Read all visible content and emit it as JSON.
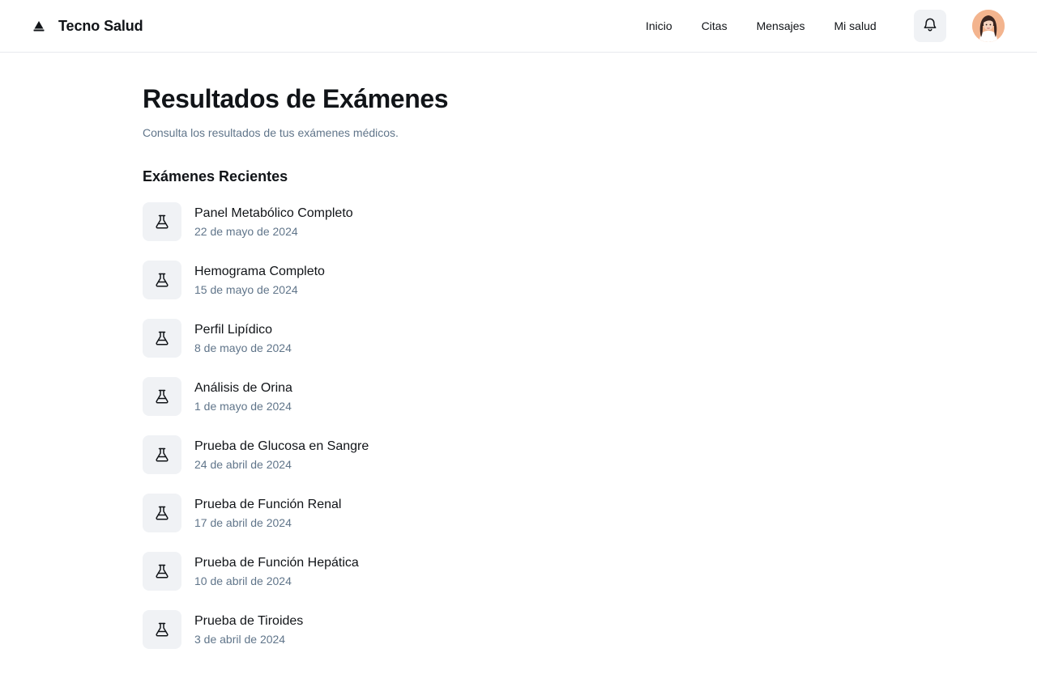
{
  "header": {
    "brand_name": "Tecno Salud",
    "logo_icon": "triangle-logo-icon",
    "nav": [
      {
        "label": "Inicio"
      },
      {
        "label": "Citas"
      },
      {
        "label": "Mensajes"
      },
      {
        "label": "Mi salud"
      }
    ],
    "notifications_icon": "bell-icon",
    "avatar_icon": "user-avatar"
  },
  "main": {
    "title": "Resultados de Exámenes",
    "subtitle": "Consulta los resultados de tus exámenes médicos.",
    "section_title": "Exámenes Recientes",
    "exams": [
      {
        "name": "Panel Metabólico Completo",
        "date": "22 de mayo de 2024",
        "icon": "flask-icon"
      },
      {
        "name": "Hemograma Completo",
        "date": "15 de mayo de 2024",
        "icon": "flask-icon"
      },
      {
        "name": "Perfil Lipídico",
        "date": "8 de mayo de 2024",
        "icon": "flask-icon"
      },
      {
        "name": "Análisis de Orina",
        "date": "1 de mayo de 2024",
        "icon": "flask-icon"
      },
      {
        "name": "Prueba de Glucosa en Sangre",
        "date": "24 de abril de 2024",
        "icon": "flask-icon"
      },
      {
        "name": "Prueba de Función Renal",
        "date": "17 de abril de 2024",
        "icon": "flask-icon"
      },
      {
        "name": "Prueba de Función Hepática",
        "date": "10 de abril de 2024",
        "icon": "flask-icon"
      },
      {
        "name": "Prueba de Tiroides",
        "date": "3 de abril de 2024",
        "icon": "flask-icon"
      }
    ]
  },
  "colors": {
    "text_primary": "#111418",
    "text_secondary": "#60758a",
    "icon_background": "#f0f2f5",
    "border": "#e8eaee",
    "avatar_background": "#f3b48e"
  }
}
